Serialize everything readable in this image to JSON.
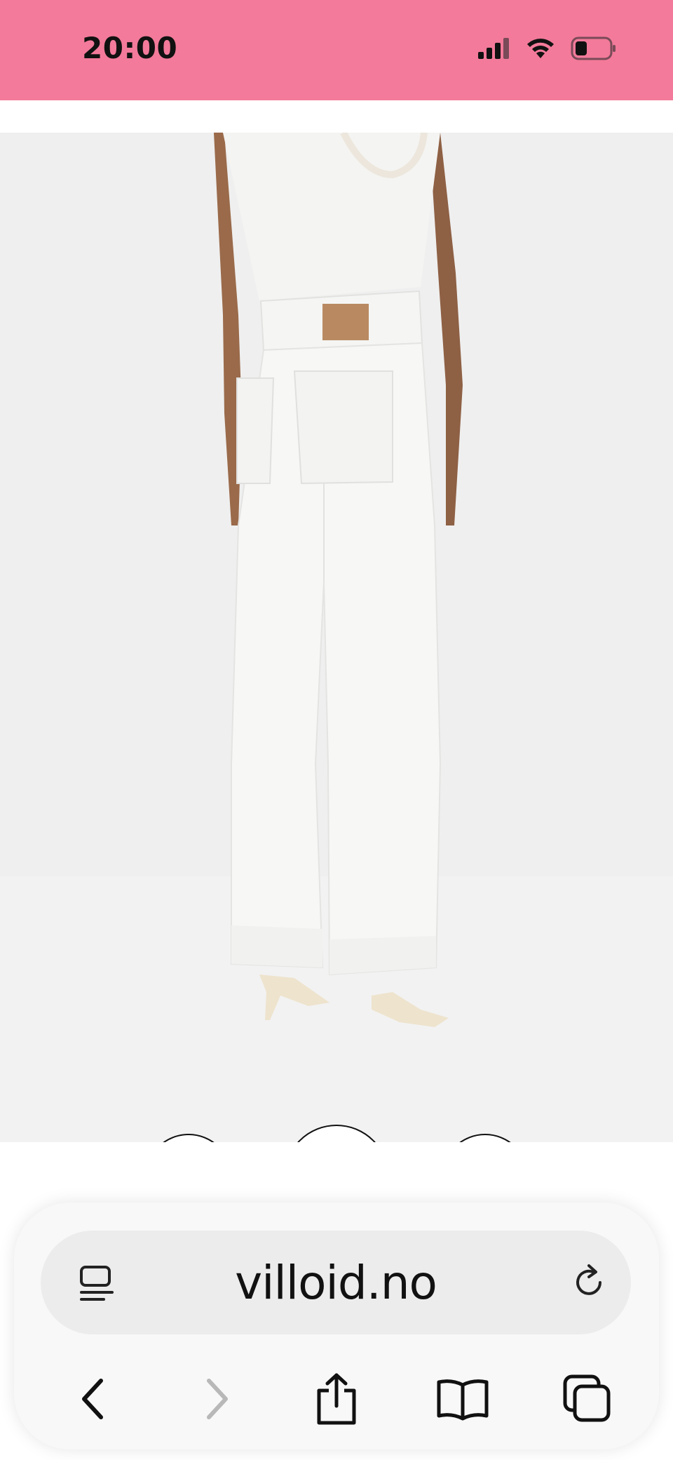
{
  "status_bar": {
    "time": "20:00",
    "background": "#f37a9a"
  },
  "gallery": {
    "image_alt": "White wide-leg jeans, back view",
    "prev_icon": "chevron-left-icon",
    "close_icon": "close-icon",
    "next_icon": "chevron-right-icon"
  },
  "browser": {
    "url": "villoid.no",
    "icons": {
      "reader": "reader-icon",
      "reload": "reload-icon",
      "back": "back-icon",
      "forward": "forward-icon",
      "share": "share-icon",
      "bookmarks": "bookmarks-icon",
      "tabs": "tabs-icon"
    },
    "forward_enabled": false
  }
}
